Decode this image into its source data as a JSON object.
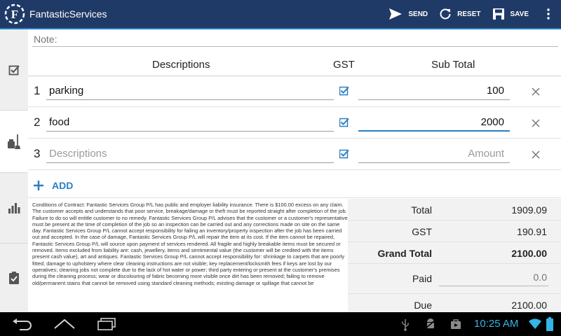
{
  "app": {
    "title": "FantasticServices",
    "logo_icon": "fantastic-logo-icon"
  },
  "actions": {
    "send_label": "SEND",
    "reset_label": "RESET",
    "save_label": "SAVE",
    "overflow_icon": "overflow-menu-icon"
  },
  "rail": {
    "items": [
      {
        "icon": "checklist-icon",
        "active": false
      },
      {
        "icon": "cleaning-icon",
        "active": true
      },
      {
        "icon": "bar-chart-icon",
        "active": false
      },
      {
        "icon": "clipboard-check-icon",
        "active": false
      }
    ]
  },
  "note": {
    "placeholder": "Note:",
    "value": ""
  },
  "table": {
    "headers": {
      "description": "Descriptions",
      "gst": "GST",
      "subtotal": "Sub Total"
    },
    "rows": [
      {
        "num": "1",
        "description": "parking",
        "gst": true,
        "amount": "100"
      },
      {
        "num": "2",
        "description": "food",
        "gst": true,
        "amount": "2000"
      },
      {
        "num": "3",
        "description": "",
        "description_placeholder": "Descriptions",
        "gst": true,
        "amount": "",
        "amount_placeholder": "Amount"
      }
    ],
    "add_label": "ADD"
  },
  "terms": {
    "text": "Conditions of Contract: Fantastic Services Group P/L has public and employer liability insurance. There is $100.00 excess on any claim. The customer accepts and understands that poor service, breakage/damage or theft must be reported straight after completion of the job. Failure to do so will entitle customer to no remedy. Fantastic Services Group P/L advises that the customer or a customer's representative must be present at the time of completion of the job so an inspection can be carried out and any corrections made on site on the same day. Fantastic Services Group P/L cannot accept responsibility for failing an inventory/property inspection after the job has been carried out and accepted. In the case of damage, Fantastic Services Group P/L will repair the item at its cost. If the item cannot be repaired, Fantastic Services Group P/L will source upon payment of services rendered. All fragile and highly breakable items must be secured or removed. Items excluded from liability are: cash, jewellery, items and sentimental value (the customer will be credited with the items present cash value), art and antiques. Fantastic Services Group P/L cannot accept responsibility for: shrinkage to carpets that are poorly fitted; damage to upholstery where clear cleaning instructions are not visible; key replacement/locksmith fees if keys are lost by our operatives; cleaning jobs not complete due to the lack of hot water or power; third party entering or present at the customer's premises during the cleaning process; wear or discolouring of fabric becoming more visible once dirt has been removed; failing to remove old/permanent stains that cannot be removed using standard cleaning methods; existing damage or spillage that cannot be"
  },
  "totals": {
    "total_label": "Total",
    "total_value": "1909.09",
    "gst_label": "GST",
    "gst_value": "190.91",
    "grand_label": "Grand Total",
    "grand_value": "2100.00",
    "paid_label": "Paid",
    "paid_placeholder": "0.0",
    "due_label": "Due",
    "due_value": "2100.00"
  },
  "system": {
    "clock": "10:25 AM",
    "status_icons": [
      "usb-icon",
      "android-debug-icon",
      "store-bag-icon",
      "wifi-icon",
      "battery-icon"
    ],
    "nav_icons": [
      "back-icon",
      "home-icon",
      "recent-apps-icon"
    ]
  },
  "colors": {
    "actionbar": "#1f3a66",
    "accent": "#2b7fc2",
    "clock": "#33b5e5"
  }
}
